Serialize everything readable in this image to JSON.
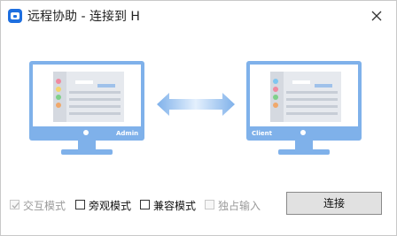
{
  "window": {
    "title": "远程协助 - 连接到 H",
    "app_icon": "teamviewer-like-app-icon",
    "close_icon": "close-icon"
  },
  "monitors": {
    "left_label": "Admin",
    "right_label": "Client"
  },
  "options": [
    {
      "label": "交互模式",
      "checked": true,
      "enabled": false
    },
    {
      "label": "旁观模式",
      "checked": false,
      "enabled": true
    },
    {
      "label": "兼容模式",
      "checked": false,
      "enabled": true
    },
    {
      "label": "独占输入",
      "checked": false,
      "enabled": false
    }
  ],
  "actions": {
    "connect_label": "连接"
  },
  "colors": {
    "monitor": "#7fb1ea",
    "arrow_light": "#d7e8fb",
    "arrow_dark": "#7fb1ea",
    "accent": "#1e6fe0"
  }
}
